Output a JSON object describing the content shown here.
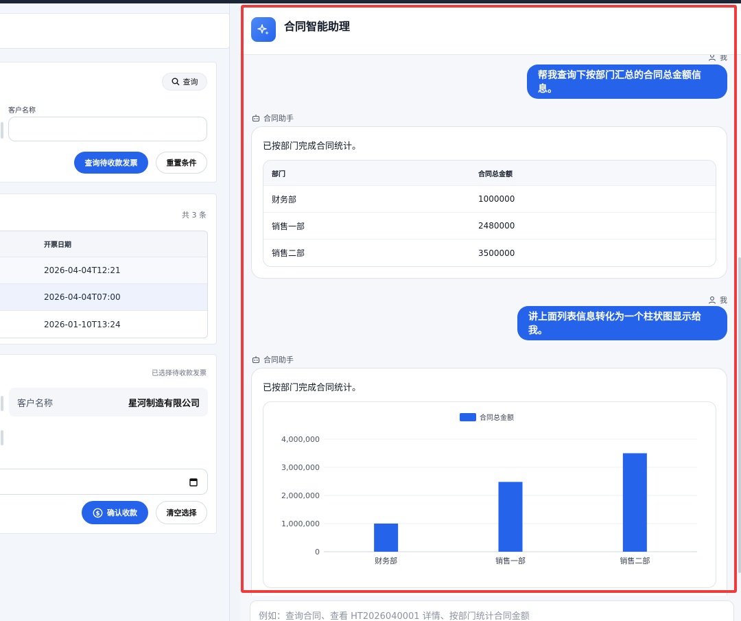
{
  "left": {
    "query_button": "查询",
    "customer_name_label": "客户名称",
    "query_pending_button": "查询待收款发票",
    "reset_button": "重置条件",
    "record_count": "共 3 条",
    "invoice_table": {
      "header": "开票日期",
      "rows": [
        "2026-04-04T12:21",
        "2026-04-04T07:00",
        "2026-01-10T13:24"
      ]
    },
    "selected_note": "已选择待收款发票",
    "customer_key": "客户名称",
    "customer_value": "星河制造有限公司",
    "confirm_button": "确认收款",
    "clear_button": "清空选择"
  },
  "chat": {
    "title": "合同智能助理",
    "user_label": "我",
    "assistant_label": "合同助手",
    "messages": {
      "user1": "帮我查询下按部门汇总的合同总金额信息。",
      "assistant1_lead": "已按部门完成合同统计。",
      "user2": "讲上面列表信息转化为一个柱状图显示给我。",
      "assistant2_lead": "已按部门完成合同统计。"
    },
    "result_table": {
      "columns": [
        "部门",
        "合同总金额"
      ],
      "rows": [
        [
          "财务部",
          "1000000"
        ],
        [
          "销售一部",
          "2480000"
        ],
        [
          "销售二部",
          "3500000"
        ]
      ]
    },
    "input_placeholder": "例如：查询合同、查看 HT2026040001 详情、按部门统计合同金额"
  },
  "colors": {
    "accent": "#2563eb",
    "highlight": "#ef3b3b"
  },
  "chart_data": {
    "type": "bar",
    "categories": [
      "财务部",
      "销售一部",
      "销售二部"
    ],
    "series": [
      {
        "name": "合同总金额",
        "values": [
          1000000,
          2480000,
          3500000
        ],
        "color": "#2563eb"
      }
    ],
    "ylim": [
      0,
      4000000
    ],
    "yticks": [
      "0",
      "1,000,000",
      "2,000,000",
      "3,000,000",
      "4,000,000"
    ],
    "grid": true,
    "legend": "top-center"
  }
}
